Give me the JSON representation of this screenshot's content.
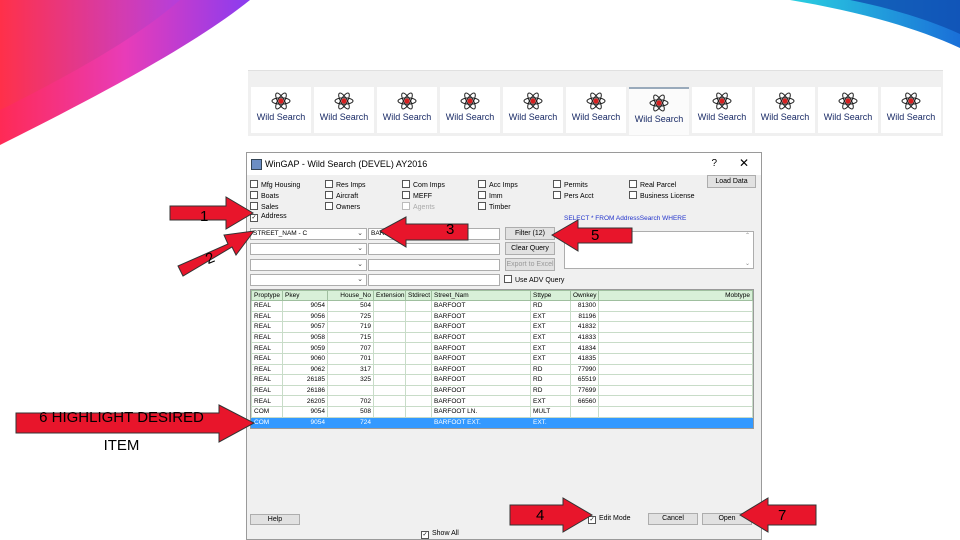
{
  "toolbar": {
    "buttons": [
      {
        "label": "Wild Search"
      },
      {
        "label": "Wild Search"
      },
      {
        "label": "Wild Search"
      },
      {
        "label": "Wild Search"
      },
      {
        "label": "Wild Search"
      },
      {
        "label": "Wild Search"
      },
      {
        "label": "Wild Search"
      },
      {
        "label": "Wild Search"
      },
      {
        "label": "Wild Search"
      },
      {
        "label": "Wild Search"
      },
      {
        "label": "Wild Search"
      }
    ]
  },
  "window": {
    "title": "WinGAP - Wild Search (DEVEL) AY2016",
    "help_char": "?",
    "close_char": "✕",
    "checkboxes": {
      "mfg_housing": "Mfg Housing",
      "boats": "Boats",
      "sales": "Sales",
      "address": "Address",
      "res_imps": "Res Imps",
      "aircraft": "Aircraft",
      "owners": "Owners",
      "com_imps": "Com Imps",
      "meff": "MEFF",
      "agents": "Agents",
      "acc_imps": "Acc Imps",
      "imm": "Imm",
      "timber": "Timber",
      "permits": "Permits",
      "pers_acct": "Pers Acct",
      "real_parcel": "Real Parcel",
      "business_license": "Business License"
    },
    "load_data_label": "Load Data",
    "sql_text": "SELECT * FROM AddressSearch WHERE",
    "field_select_value": "STREET_NAM - C",
    "field_input_value": "BARFOOT",
    "filter_label": "Filter (12)",
    "clear_query_label": "Clear Query",
    "export_label": "Export to Excel",
    "use_adv_query_label": "Use ADV Query",
    "table": {
      "columns": [
        "Proptype",
        "Pkey",
        "House_No",
        "Extension",
        "Stdirect",
        "Street_Nam",
        "Sttype",
        "Ownkey",
        "Mobtype"
      ],
      "rows": [
        [
          "REAL",
          "9054",
          "504",
          "",
          "",
          "BARFOOT",
          "RD",
          "81300",
          ""
        ],
        [
          "REAL",
          "9056",
          "725",
          "",
          "",
          "BARFOOT",
          "EXT",
          "81196",
          ""
        ],
        [
          "REAL",
          "9057",
          "719",
          "",
          "",
          "BARFOOT",
          "EXT",
          "41832",
          ""
        ],
        [
          "REAL",
          "9058",
          "715",
          "",
          "",
          "BARFOOT",
          "EXT",
          "41833",
          ""
        ],
        [
          "REAL",
          "9059",
          "707",
          "",
          "",
          "BARFOOT",
          "EXT",
          "41834",
          ""
        ],
        [
          "REAL",
          "9060",
          "701",
          "",
          "",
          "BARFOOT",
          "EXT",
          "41835",
          ""
        ],
        [
          "REAL",
          "9062",
          "317",
          "",
          "",
          "BARFOOT",
          "RD",
          "77990",
          ""
        ],
        [
          "REAL",
          "26185",
          "325",
          "",
          "",
          "BARFOOT",
          "RD",
          "65519",
          ""
        ],
        [
          "REAL",
          "26186",
          "",
          "",
          "",
          "BARFOOT",
          "RD",
          "77699",
          ""
        ],
        [
          "REAL",
          "26205",
          "702",
          "",
          "",
          "BARFOOT",
          "EXT",
          "66560",
          ""
        ],
        [
          "COM",
          "9054",
          "508",
          "",
          "",
          "BARFOOT LN.",
          "MULT",
          "",
          ""
        ],
        [
          "COM",
          "9054",
          "724",
          "",
          "",
          "BARFOOT EXT.",
          "EXT.",
          "",
          ""
        ]
      ],
      "highlighted_row": 11
    },
    "help_label": "Help",
    "edit_mode_label": "Edit Mode",
    "cancel_label": "Cancel",
    "open_label": "Open",
    "show_all_label": "Show All"
  },
  "annotations": {
    "n1": "1",
    "n2": "2",
    "n3": "3",
    "n4": "4",
    "n5": "5",
    "n7": "7",
    "note": "6 HIGHLIGHT DESIRED ITEM"
  },
  "colors": {
    "accent_arrow": "#e8152b",
    "highlight_row": "#3399ff",
    "header_green": "#d8f0d8"
  }
}
